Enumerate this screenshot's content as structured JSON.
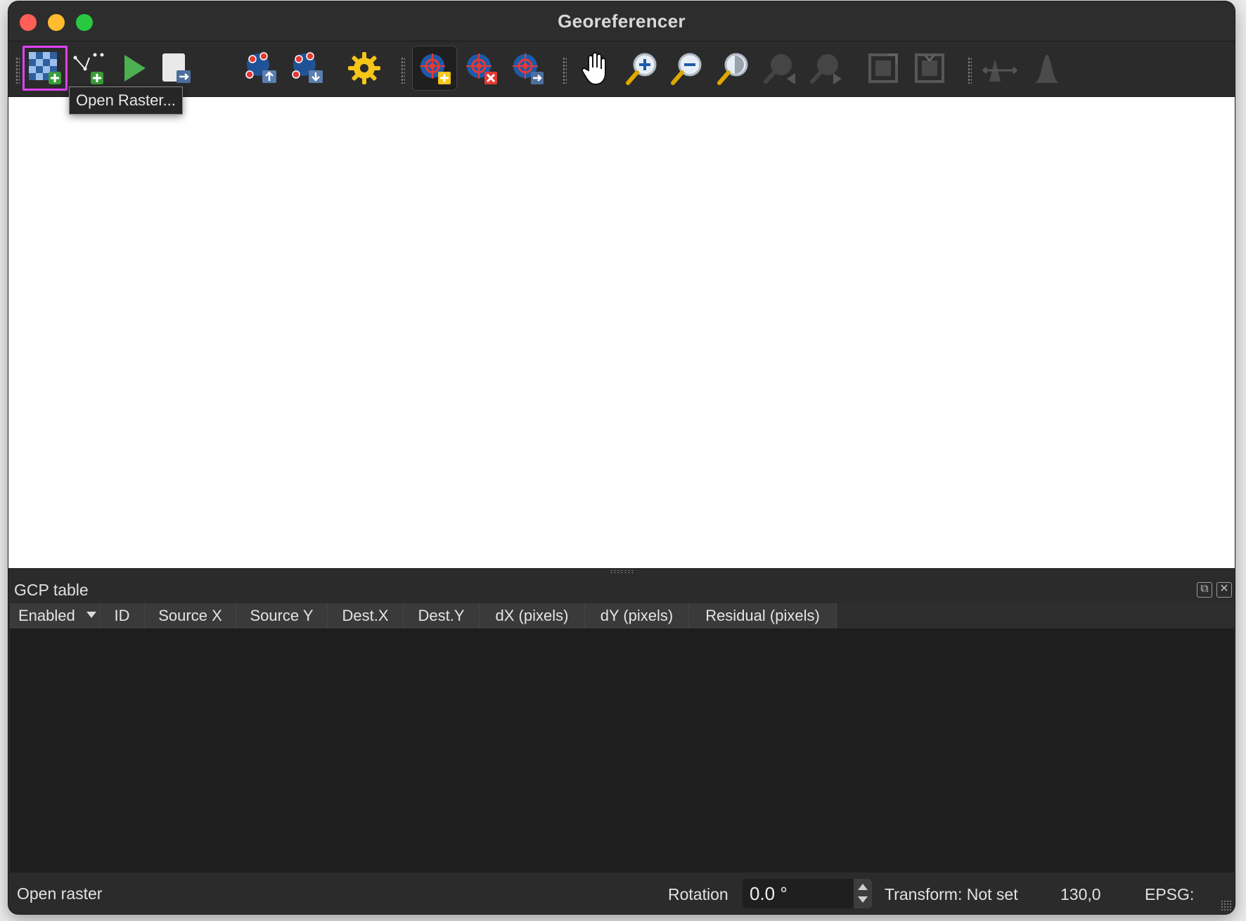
{
  "window": {
    "title": "Georeferencer"
  },
  "toolbar": {
    "buttons": [
      {
        "name": "open-raster",
        "icon": "raster-add-icon",
        "tooltip": "Open Raster..."
      },
      {
        "name": "add-point",
        "icon": "vector-point-add-icon"
      },
      {
        "name": "start-georeferencing",
        "icon": "play-icon"
      },
      {
        "name": "generate-gdal-script",
        "icon": "script-export-icon"
      },
      {
        "name": "load-gcp-points",
        "icon": "gcp-load-icon"
      },
      {
        "name": "save-gcp-points",
        "icon": "gcp-save-icon"
      },
      {
        "name": "transformation-settings",
        "icon": "gear-icon"
      },
      {
        "name": "add-point-tool",
        "icon": "gcp-add-icon",
        "active": true
      },
      {
        "name": "delete-point-tool",
        "icon": "gcp-delete-icon"
      },
      {
        "name": "move-point-tool",
        "icon": "gcp-move-icon"
      },
      {
        "name": "pan-tool",
        "icon": "hand-icon"
      },
      {
        "name": "zoom-in-tool",
        "icon": "zoom-in-icon"
      },
      {
        "name": "zoom-out-tool",
        "icon": "zoom-out-icon"
      },
      {
        "name": "zoom-to-layer",
        "icon": "zoom-full-icon"
      },
      {
        "name": "zoom-last",
        "icon": "zoom-last-icon",
        "disabled": true
      },
      {
        "name": "zoom-next",
        "icon": "zoom-next-icon",
        "disabled": true
      },
      {
        "name": "link-georeferencer-to-qgis",
        "icon": "link-geo-icon",
        "disabled": true
      },
      {
        "name": "link-qgis-to-georeferencer",
        "icon": "link-qgis-icon",
        "disabled": true
      },
      {
        "name": "full-histogram-stretch",
        "icon": "histogram-stretch-icon",
        "disabled": true
      },
      {
        "name": "local-histogram-stretch",
        "icon": "histogram-local-icon",
        "disabled": true
      }
    ],
    "tooltip_text": "Open Raster..."
  },
  "gcp_panel": {
    "title": "GCP table",
    "columns": [
      "Enabled",
      "ID",
      "Source X",
      "Source Y",
      "Dest.X",
      "Dest.Y",
      "dX (pixels)",
      "dY (pixels)",
      "Residual (pixels)"
    ],
    "rows": []
  },
  "statusbar": {
    "message": "Open raster",
    "rotation_label": "Rotation",
    "rotation_value": "0.0 °",
    "transform": "Transform: Not set",
    "coordinates": "130,0",
    "epsg": "EPSG:"
  },
  "colors": {
    "highlight": "#e040fb",
    "play": "#4caf50",
    "gear": "#f5c518",
    "gcp_red": "#e53935",
    "gcp_blue": "#1e5aa8"
  }
}
